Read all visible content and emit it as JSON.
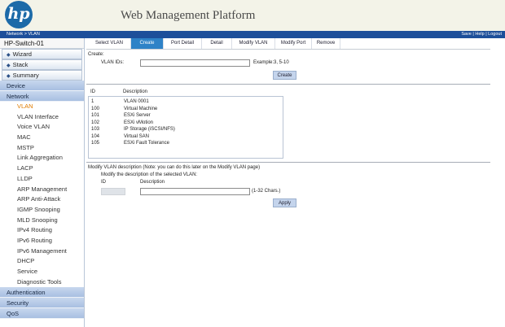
{
  "header": {
    "logo_text": "hp",
    "title": "Web Management Platform"
  },
  "navbar": {
    "breadcrumb": "Network > VLAN",
    "links": [
      "Save",
      "Help",
      "Logout"
    ],
    "separator": " | "
  },
  "sidebar": {
    "device_name": "HP-Switch-01",
    "wizards": [
      "Wizard",
      "Stack",
      "Summary"
    ],
    "sections_top": [
      "Device",
      "Network"
    ],
    "network_items": [
      "VLAN",
      "VLAN Interface",
      "Voice VLAN",
      "MAC",
      "MSTP",
      "Link Aggregation",
      "LACP",
      "LLDP",
      "ARP Management",
      "ARP Anti-Attack",
      "IGMP Snooping",
      "MLD Snooping",
      "IPv4 Routing",
      "IPv6 Routing",
      "IPv6 Management",
      "DHCP",
      "Service",
      "Diagnostic Tools"
    ],
    "sections_bottom": [
      "Authentication",
      "Security",
      "QoS"
    ]
  },
  "tabs": [
    "Select VLAN",
    "Create",
    "Port Detail",
    "Detail",
    "Modify VLAN",
    "Modify Port",
    "Remove"
  ],
  "create": {
    "heading": "Create:",
    "vlan_ids_label": "VLAN IDs:",
    "vlan_ids_value": "",
    "example": "Example:3, 5-10",
    "button": "Create"
  },
  "vlan_table": {
    "headers": [
      "ID",
      "Description"
    ],
    "rows": [
      [
        "1",
        "VLAN 0001"
      ],
      [
        "100",
        "Virtual Machine"
      ],
      [
        "101",
        "ESXi Server"
      ],
      [
        "102",
        "ESXi vMotion"
      ],
      [
        "103",
        "IP Storage (iSCSI/NFS)"
      ],
      [
        "104",
        "Virtual SAN"
      ],
      [
        "105",
        "ESXi Fault Tolerance"
      ]
    ]
  },
  "modify": {
    "heading": "Modify VLAN description (Note: you can do this later on the Modify VLAN page)",
    "subheading": "Modify the description of the selected VLAN:",
    "id_label": "ID",
    "desc_label": "Description",
    "desc_value": "",
    "hint": "(1-32 Chars.)",
    "button": "Apply"
  }
}
